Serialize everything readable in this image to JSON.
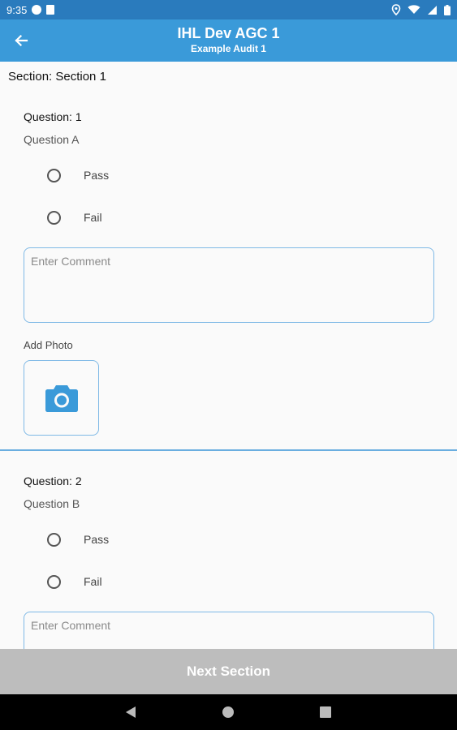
{
  "status_bar": {
    "time": "9:35",
    "left_icons": [
      "data-saver-icon",
      "sim-card-icon"
    ],
    "right_icons": [
      "location-icon",
      "wifi-icon",
      "signal-icon",
      "battery-icon"
    ]
  },
  "app_bar": {
    "title": "IHL Dev AGC 1",
    "subtitle": "Example Audit 1",
    "back_icon": "arrow-back-icon"
  },
  "section": {
    "title": "Section: Section 1"
  },
  "questions": [
    {
      "title": "Question: 1",
      "text": "Question A",
      "options": [
        "Pass",
        "Fail"
      ],
      "comment_placeholder": "Enter Comment",
      "comment_value": "",
      "add_photo_label": "Add Photo",
      "photo_icon": "camera-icon"
    },
    {
      "title": "Question: 2",
      "text": "Question B",
      "options": [
        "Pass",
        "Fail"
      ],
      "comment_placeholder": "Enter Comment",
      "comment_value": ""
    }
  ],
  "footer": {
    "next_label": "Next Section"
  },
  "nav": {
    "icons": [
      "back-triangle-icon",
      "home-circle-icon",
      "recents-square-icon"
    ]
  },
  "colors": {
    "status_bar": "#2a7bbd",
    "app_bar": "#3a9ad9",
    "accent": "#3a9ad9",
    "border": "#7fb9e6",
    "next_disabled": "#bdbdbd"
  }
}
